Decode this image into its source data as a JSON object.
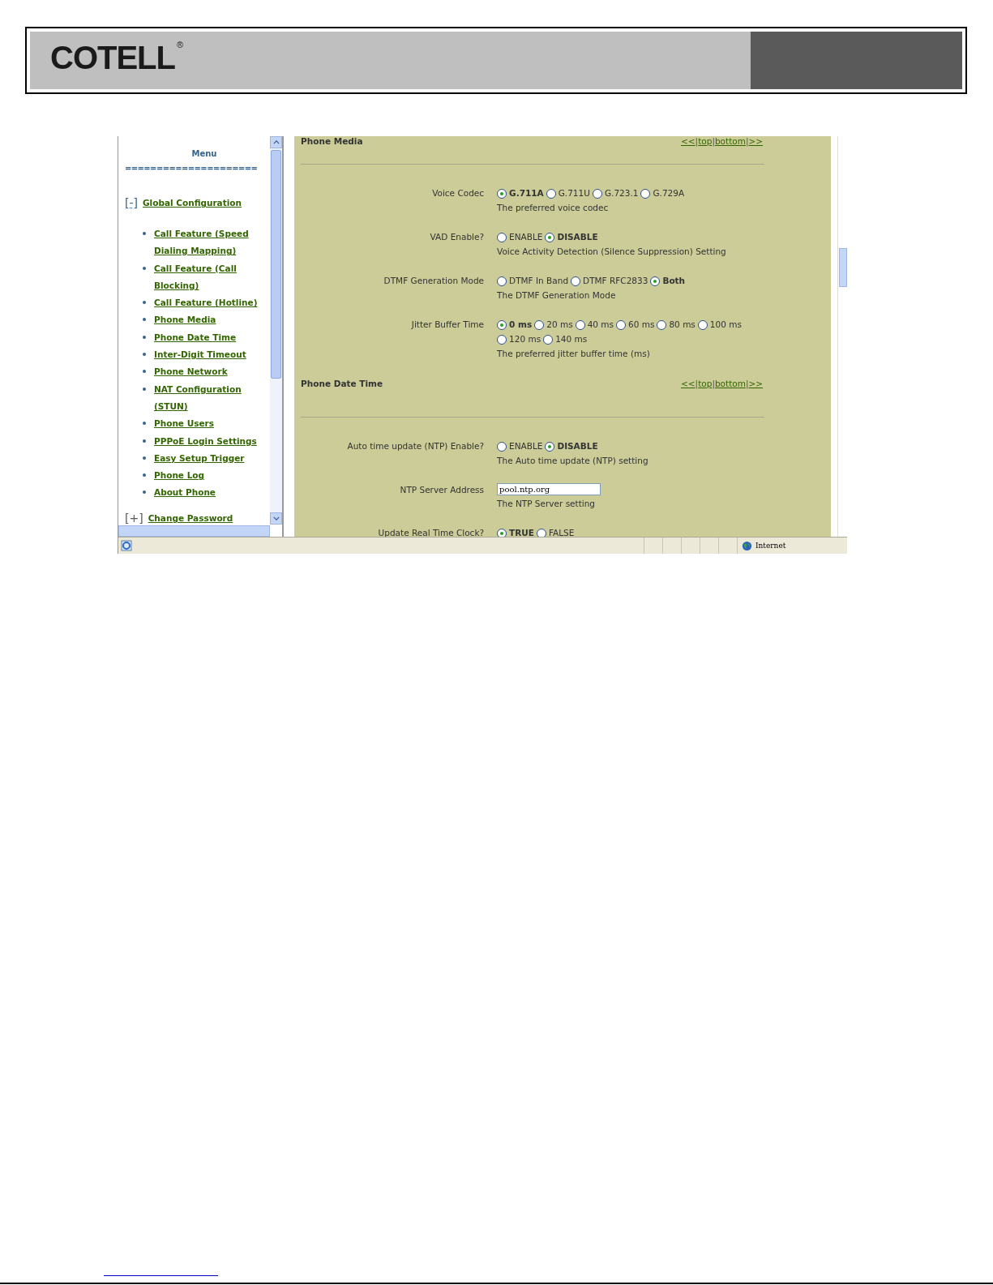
{
  "header": {
    "logo": "COTELL",
    "logo_mark": "®"
  },
  "sidebar": {
    "title": "Menu",
    "separator": "=====================",
    "groups": [
      {
        "toggle": "[-]",
        "label": "Global Configuration",
        "expanded": true,
        "children": [
          {
            "label": "Call Feature (Speed Dialing Mapping)"
          },
          {
            "label": "Call Feature (Call Blocking)"
          },
          {
            "label": "Call Feature (Hotline)"
          },
          {
            "label": "Phone Media"
          },
          {
            "label": "Phone Date Time"
          },
          {
            "label": "Inter-Digit Timeout"
          },
          {
            "label": "Phone Network"
          },
          {
            "label": "NAT Configuration (STUN)"
          },
          {
            "label": "Phone Users"
          },
          {
            "label": "PPPoE Login Settings"
          },
          {
            "label": "Easy Setup Trigger"
          },
          {
            "label": "Phone Log"
          },
          {
            "label": "About Phone"
          }
        ]
      },
      {
        "toggle": "[+]",
        "label": "Change Password",
        "expanded": false
      }
    ]
  },
  "sections": [
    {
      "title": "Phone Media",
      "nav": [
        "<<",
        "top",
        "bottom",
        ">>"
      ],
      "nav_separator": "|",
      "fields": [
        {
          "kind": "radio",
          "label": "Voice Codec",
          "options": [
            {
              "label": "G.711A",
              "selected": true
            },
            {
              "label": "G.711U",
              "selected": false
            },
            {
              "label": "G.723.1",
              "selected": false
            },
            {
              "label": "G.729A",
              "selected": false
            }
          ],
          "description": "The preferred voice codec"
        },
        {
          "kind": "radio",
          "label": "VAD Enable?",
          "options": [
            {
              "label": "ENABLE",
              "selected": false
            },
            {
              "label": "DISABLE",
              "selected": true
            }
          ],
          "description": "Voice Activity Detection (Silence Suppression) Setting"
        },
        {
          "kind": "radio",
          "label": "DTMF Generation Mode",
          "options": [
            {
              "label": "DTMF In Band",
              "selected": false
            },
            {
              "label": "DTMF RFC2833",
              "selected": false
            },
            {
              "label": "Both",
              "selected": true
            }
          ],
          "description": "The DTMF Generation Mode"
        },
        {
          "kind": "radio",
          "label": "Jitter Buffer Time",
          "options": [
            {
              "label": "0 ms",
              "selected": true
            },
            {
              "label": "20 ms",
              "selected": false
            },
            {
              "label": "40 ms",
              "selected": false
            },
            {
              "label": "60 ms",
              "selected": false
            },
            {
              "label": "80 ms",
              "selected": false
            },
            {
              "label": "100 ms",
              "selected": false
            },
            {
              "label": "120 ms",
              "selected": false
            },
            {
              "label": "140 ms",
              "selected": false
            }
          ],
          "description": "The preferred jitter buffer time (ms)"
        }
      ]
    },
    {
      "title": "Phone Date Time",
      "nav": [
        "<<",
        "top",
        "bottom",
        ">>"
      ],
      "nav_separator": "|",
      "fields": [
        {
          "kind": "radio",
          "label": "Auto time update (NTP) Enable?",
          "options": [
            {
              "label": "ENABLE",
              "selected": false
            },
            {
              "label": "DISABLE",
              "selected": true
            }
          ],
          "description": "The Auto time update (NTP) setting"
        },
        {
          "kind": "text",
          "label": "NTP Server Address",
          "value": "pool.ntp.org",
          "description": "The NTP Server setting"
        },
        {
          "kind": "radio",
          "label": "Update Real Time Clock?",
          "options": [
            {
              "label": "TRUE",
              "selected": true
            },
            {
              "label": "FALSE",
              "selected": false
            }
          ]
        }
      ]
    }
  ],
  "status_bar": {
    "zone": "Internet"
  }
}
